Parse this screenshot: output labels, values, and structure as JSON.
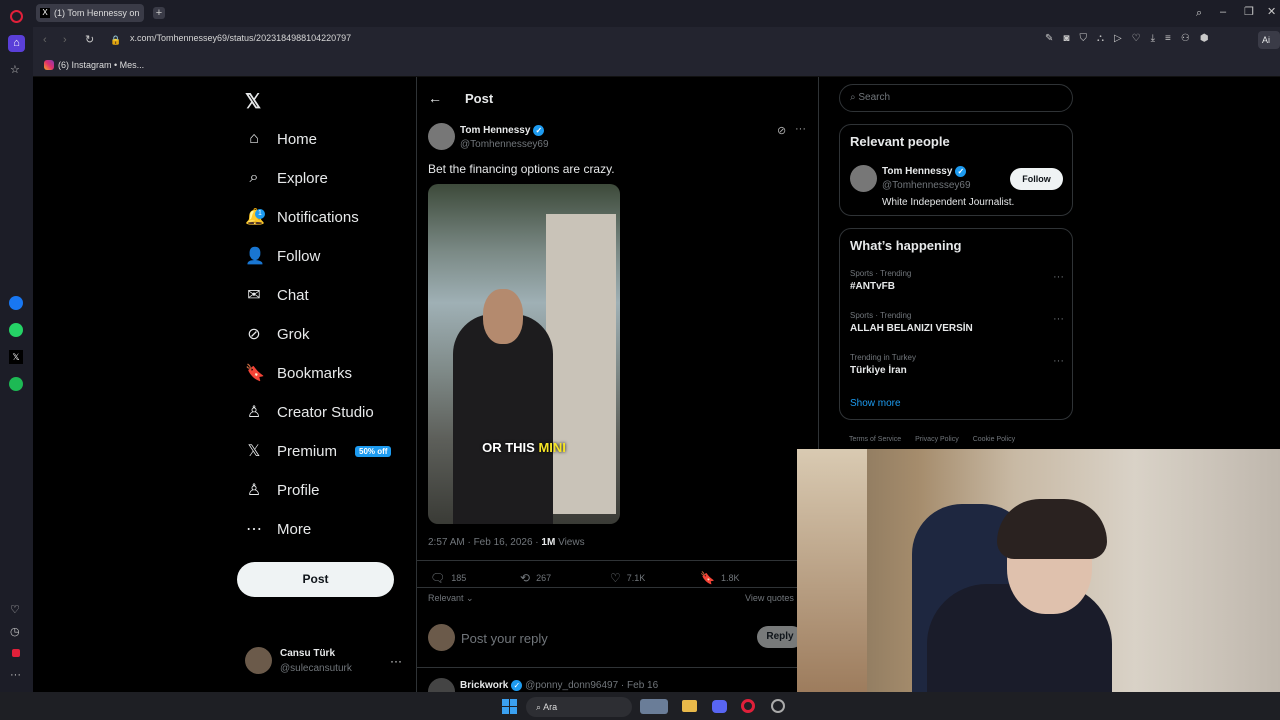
{
  "browser": {
    "tab_title": "(1) Tom Hennessy on",
    "url": "x.com/Tomhennessey69/status/2023184988104220797",
    "bookmark": "(6) Instagram • Mes...",
    "ai_label": "Ai"
  },
  "nav": {
    "items": [
      {
        "label": "Home",
        "icon": "home-icon"
      },
      {
        "label": "Explore",
        "icon": "search-icon"
      },
      {
        "label": "Notifications",
        "icon": "bell-icon",
        "badge": "1"
      },
      {
        "label": "Follow",
        "icon": "person-add-icon"
      },
      {
        "label": "Chat",
        "icon": "mail-icon"
      },
      {
        "label": "Grok",
        "icon": "grok-icon"
      },
      {
        "label": "Bookmarks",
        "icon": "bookmark-icon"
      },
      {
        "label": "Creator Studio",
        "icon": "creator-icon"
      },
      {
        "label": "Premium",
        "icon": "x-icon",
        "badge": "50% off"
      },
      {
        "label": "Profile",
        "icon": "person-icon"
      },
      {
        "label": "More",
        "icon": "more-circle-icon"
      }
    ],
    "post_button": "Post",
    "account_name": "Cansu Türk",
    "account_handle": "@sulecansuturk"
  },
  "post": {
    "header": "Post",
    "author": "Tom Hennessy",
    "handle": "@Tomhennessey69",
    "text": "Bet the financing options are crazy.",
    "caption_a": "OR THIS ",
    "caption_b": "MINI",
    "timestamp": "2:57 AM · Feb 16, 2026 · ",
    "views_count": "1M",
    "views_label": " Views",
    "replies": "185",
    "reposts": "267",
    "likes": "7.1K",
    "bookmarks": "1.8K",
    "sort": "Relevant",
    "view_quotes": "View quotes",
    "reply_placeholder": "Post your reply",
    "reply_button": "Reply",
    "next_author": "Brickwork",
    "next_handle": "@ponny_donn96497 · Feb 16"
  },
  "sidebar": {
    "search_placeholder": "Search",
    "relevant_title": "Relevant people",
    "person_name": "Tom Hennessy",
    "person_handle": "@Tomhennessey69",
    "person_bio": "White Independent Journalist.",
    "follow_button": "Follow",
    "happening_title": "What’s happening",
    "trends": [
      {
        "category": "Sports · Trending",
        "name": "#ANTvFB"
      },
      {
        "category": "Sports · Trending",
        "name": "ALLAH BELANIZI VERSİN"
      },
      {
        "category": "Trending in Turkey",
        "name": "Türkiye İran"
      }
    ],
    "show_more": "Show more",
    "footer": [
      "Terms of Service",
      "Privacy Policy",
      "Cookie Policy"
    ]
  },
  "taskbar": {
    "search_label": "Ara"
  },
  "colors": {
    "accent": "#1d9bf0",
    "caption_highlight": "#f5e427"
  }
}
